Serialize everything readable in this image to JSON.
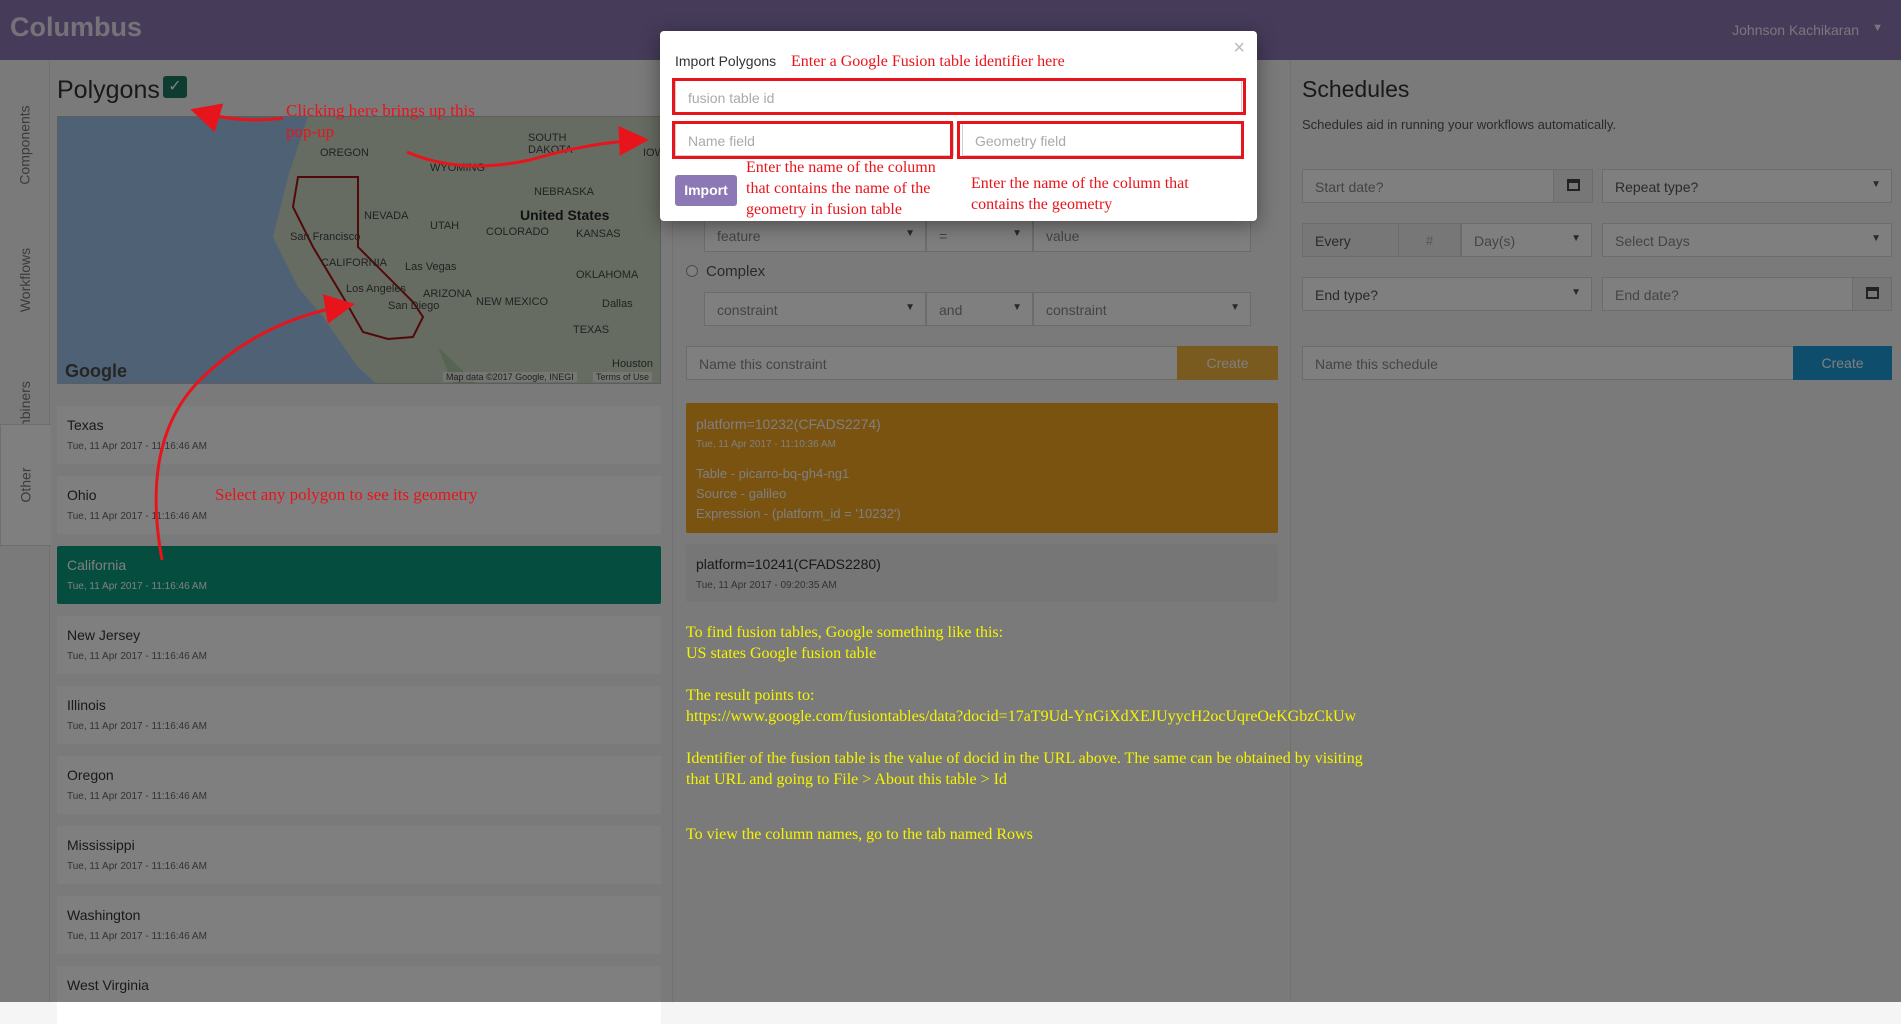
{
  "app": {
    "title": "Columbus",
    "user": "Johnson Kachikaran"
  },
  "side_tabs": [
    "Components",
    "Workflows",
    "Combiners",
    "Other"
  ],
  "polygons": {
    "title": "Polygons",
    "map_labels": {
      "oregon": "OREGON",
      "south_dakota": "SOUTH\nDAKOTA",
      "wyoming": "WYOMING",
      "iowa": "IOW",
      "nebraska": "NEBRASKA",
      "nevada": "NEVADA",
      "utah": "UTAH",
      "united_states": "United States",
      "colorado": "COLORADO",
      "kansas": "KANSAS",
      "san_francisco": "San Francisco",
      "california": "CALIFORNIA",
      "las_vegas": "Las Vegas",
      "oklahoma": "OKLAHOMA",
      "arizona": "ARIZONA",
      "los_angeles": "Los Angeles",
      "new_mexico": "NEW MEXICO",
      "dallas": "Dallas",
      "san_diego": "San Diego",
      "texas": "TEXAS",
      "houston": "Houston",
      "google": "Google",
      "map_data": "Map data ©2017 Google, INEGI",
      "terms": "Terms of Use"
    },
    "items": [
      {
        "name": "Texas",
        "time": "Tue, 11 Apr 2017 - 11:16:46 AM",
        "active": false
      },
      {
        "name": "Ohio",
        "time": "Tue, 11 Apr 2017 - 11:16:46 AM",
        "active": false
      },
      {
        "name": "California",
        "time": "Tue, 11 Apr 2017 - 11:16:46 AM",
        "active": true
      },
      {
        "name": "New Jersey",
        "time": "Tue, 11 Apr 2017 - 11:16:46 AM",
        "active": false
      },
      {
        "name": "Illinois",
        "time": "Tue, 11 Apr 2017 - 11:16:46 AM",
        "active": false
      },
      {
        "name": "Oregon",
        "time": "Tue, 11 Apr 2017 - 11:16:46 AM",
        "active": false
      },
      {
        "name": "Mississippi",
        "time": "Tue, 11 Apr 2017 - 11:16:46 AM",
        "active": false
      },
      {
        "name": "Washington",
        "time": "Tue, 11 Apr 2017 - 11:16:46 AM",
        "active": false
      },
      {
        "name": "West Virginia",
        "time": "",
        "active": false
      }
    ]
  },
  "constraints": {
    "feature_select": "feature",
    "operator_select": "=",
    "value_placeholder": "value",
    "complex_label": "Complex",
    "constraint_left": "constraint",
    "and_select": "and",
    "constraint_right": "constraint",
    "name_placeholder": "Name this constraint",
    "create_label": "Create",
    "cards": [
      {
        "title": "platform=10232(CFADS2274)",
        "time": "Tue, 11 Apr 2017 - 11:10:36 AM",
        "table": "Table - picarro-bq-gh4-ng1",
        "source": "Source - galileo",
        "expression": "Expression - (platform_id = '10232')"
      },
      {
        "title": "platform=10241(CFADS2280)",
        "time": "Tue, 11 Apr 2017 - 09:20:35 AM"
      }
    ]
  },
  "schedules": {
    "title": "Schedules",
    "description": "Schedules aid in running your workflows automatically.",
    "start_date_placeholder": "Start date?",
    "repeat_type": "Repeat type?",
    "every_label": "Every",
    "num_placeholder": "#",
    "days_select": "Day(s)",
    "select_days": "Select Days",
    "end_type": "End type?",
    "end_date_placeholder": "End date?",
    "name_placeholder": "Name this schedule",
    "create_label": "Create"
  },
  "modal": {
    "title": "Import Polygons",
    "close": "×",
    "fusion_placeholder": "fusion table id",
    "name_field_placeholder": "Name field",
    "geometry_field_placeholder": "Geometry field",
    "import_label": "Import"
  },
  "annotations": {
    "enter_id": "Enter a Google Fusion table identifier here",
    "click_here": "Clicking here brings up this\npop-up",
    "name_col": "Enter the name of the column\nthat contains the name of the\ngeometry in fusion table",
    "geom_col": "Enter the name of the column that\ncontains the geometry",
    "select_polygon": "Select any polygon to see its geometry",
    "help_1": "To find fusion tables, Google something like this:",
    "help_2": "US states Google fusion table",
    "help_3": "The result points to:",
    "help_4": "https://www.google.com/fusiontables/data?docid=17aT9Ud-YnGiXdXEJUyycH2ocUqreOeKGbzCkUw",
    "help_5": "Identifier of the fusion table is the value of docid in the URL above. The same can be obtained by visiting",
    "help_6": "that URL and going to File > About this table > Id",
    "help_7": "To view the column names, go to the tab named Rows"
  }
}
